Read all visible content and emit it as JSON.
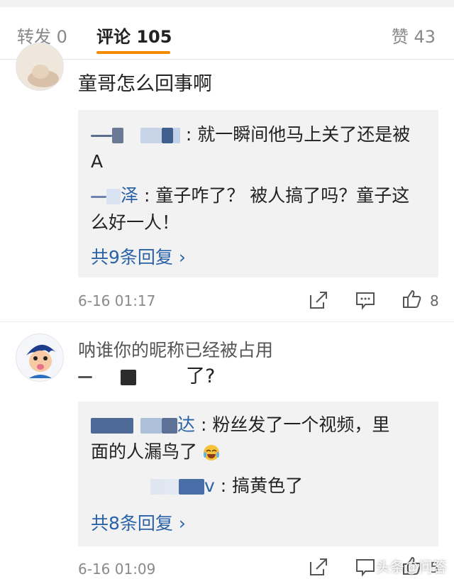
{
  "tabs": {
    "reposts": "转发 0",
    "comments": "评论 105",
    "likes": "赞 43"
  },
  "comments": [
    {
      "text": "童哥怎么回事啊",
      "replies": [
        {
          "text_line1": ": 就一瞬间他马上关了还是被",
          "text_line2": "A"
        },
        {
          "name_end": "泽",
          "text_line1": ": 童子咋了？ 被人搞了吗？童子这",
          "text_line2": "么好一人！"
        }
      ],
      "more": "共9条回复 ›",
      "time": "6-16 01:17",
      "like_count": "8",
      "icons": [
        "share-icon",
        "comment-icon",
        "like-icon"
      ]
    },
    {
      "username": "呐谁你的昵称已经被占用",
      "text": "了?",
      "replies": [
        {
          "name_end": "达",
          "text_line1": ": 粉丝发了一个视频，里",
          "text_line2": "面的人漏鸟了"
        },
        {
          "name_end": "v",
          "text_line1": ": 搞黄色了"
        }
      ],
      "more": "共8条回复 ›",
      "time": "6-16 01:09",
      "like_count": "5",
      "icons": [
        "share-icon",
        "comment-icon",
        "like-icon"
      ]
    }
  ],
  "watermark": "头条@问答",
  "colors": {
    "accent": "#f48a00",
    "link": "#2a62a8",
    "reply_bg": "#f2f2f2"
  }
}
